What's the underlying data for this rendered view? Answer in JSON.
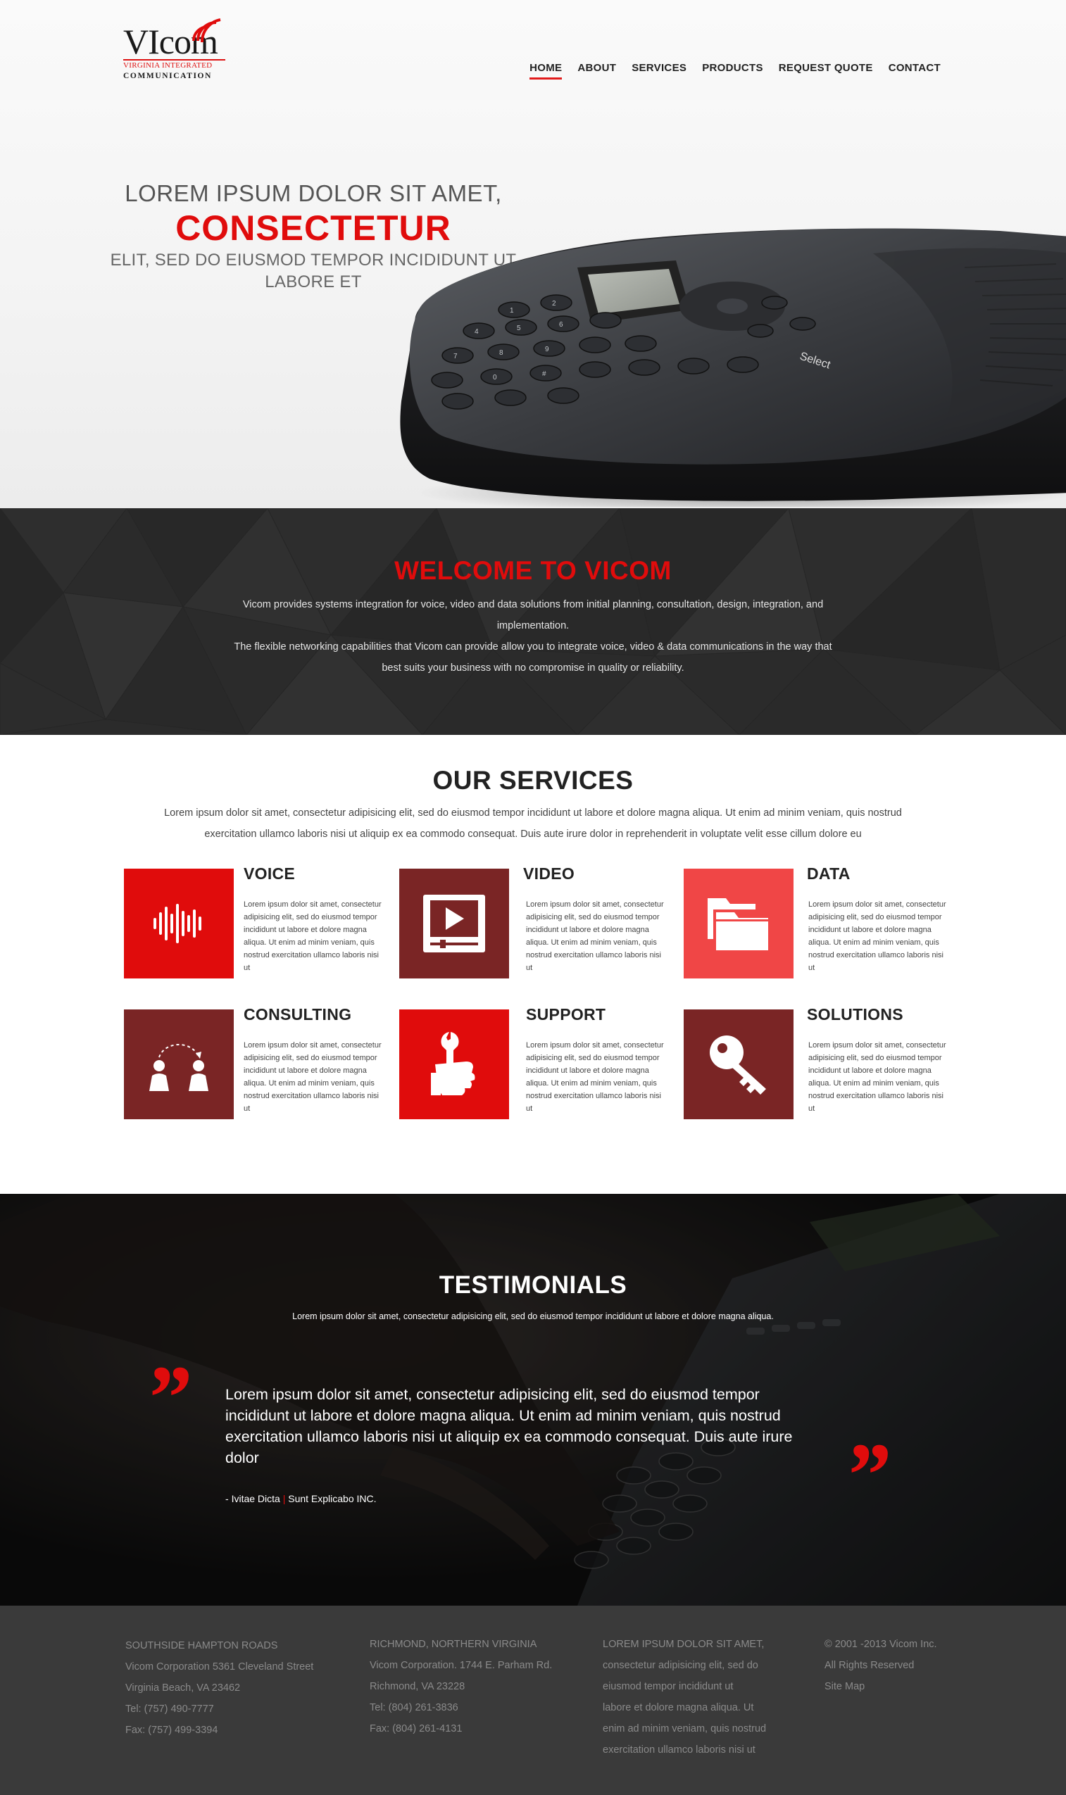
{
  "logo": {
    "main": "VIcom",
    "line1": "VIRGINIA INTEGRATED",
    "line2": "COMMUNICATION"
  },
  "nav": {
    "items": [
      {
        "label": "HOME",
        "active": true
      },
      {
        "label": "ABOUT"
      },
      {
        "label": "SERVICES"
      },
      {
        "label": "PRODUCTS"
      },
      {
        "label": "REQUEST QUOTE"
      },
      {
        "label": "CONTACT"
      }
    ]
  },
  "hero": {
    "line1": "LOREM IPSUM DOLOR SIT AMET,",
    "line2": "CONSECTETUR",
    "line3": "ELIT, SED DO EIUSMOD TEMPOR INCIDIDUNT UT LABORE ET",
    "phone_select_label": "Select"
  },
  "welcome": {
    "title": "WELCOME TO VICOM",
    "paragraph1": "Vicom provides systems integration for voice, video and data solutions from initial planning, consultation, design, integration, and implementation.",
    "paragraph2": "The flexible networking capabilities that Vicom can provide allow you to integrate voice, video & data communications in the way that best suits your business with no compromise in quality or reliability."
  },
  "services": {
    "title": "OUR SERVICES",
    "intro": "Lorem ipsum dolor sit amet, consectetur adipisicing elit, sed do eiusmod tempor incididunt ut labore et dolore magna aliqua. Ut enim ad minim veniam, quis nostrud exercitation ullamco laboris nisi ut aliquip ex ea commodo consequat. Duis aute irure dolor in reprehenderit in voluptate velit esse cillum dolore eu",
    "items": [
      {
        "title": "VOICE",
        "icon": "sound-wave-icon",
        "color": "#e00c0c",
        "text": "Lorem ipsum dolor sit amet, consectetur adipisicing elit, sed do eiusmod tempor incididunt ut labore et dolore magna aliqua. Ut enim ad minim veniam, quis nostrud exercitation ullamco laboris nisi ut"
      },
      {
        "title": "VIDEO",
        "icon": "video-player-icon",
        "color": "#7a2525",
        "text": "Lorem ipsum dolor sit amet, consectetur adipisicing elit, sed do eiusmod tempor incididunt ut labore et dolore magna aliqua. Ut enim ad minim veniam, quis nostrud exercitation ullamco laboris nisi ut"
      },
      {
        "title": "DATA",
        "icon": "folders-icon",
        "color": "#f04646",
        "text": "Lorem ipsum dolor sit amet, consectetur adipisicing elit, sed do eiusmod tempor incididunt ut labore et dolore magna aliqua. Ut enim ad minim veniam, quis nostrud exercitation ullamco laboris nisi ut"
      },
      {
        "title": "CONSULTING",
        "icon": "people-talking-icon",
        "color": "#7a2525",
        "text": "Lorem ipsum dolor sit amet, consectetur adipisicing elit, sed do eiusmod tempor incididunt ut labore et dolore magna aliqua. Ut enim ad minim veniam, quis nostrud exercitation ullamco laboris nisi ut"
      },
      {
        "title": "SUPPORT",
        "icon": "wrench-hand-icon",
        "color": "#e00c0c",
        "text": "Lorem ipsum dolor sit amet, consectetur adipisicing elit, sed do eiusmod tempor incididunt ut labore et dolore magna aliqua. Ut enim ad minim veniam, quis nostrud exercitation ullamco laboris nisi ut"
      },
      {
        "title": "SOLUTIONS",
        "icon": "key-icon",
        "color": "#7a2525",
        "text": "Lorem ipsum dolor sit amet, consectetur adipisicing elit, sed do eiusmod tempor incididunt ut labore et dolore magna aliqua. Ut enim ad minim veniam, quis nostrud exercitation ullamco laboris nisi ut"
      }
    ]
  },
  "testimonials": {
    "title": "TESTIMONIALS",
    "subtitle": "Lorem ipsum dolor sit amet, consectetur adipisicing elit, sed do eiusmod tempor incididunt ut labore et dolore magna aliqua.",
    "quote": "Lorem ipsum dolor sit amet, consectetur adipisicing elit, sed do eiusmod tempor incididunt ut labore et dolore magna aliqua. Ut enim ad minim veniam, quis nostrud exercitation ullamco laboris nisi ut aliquip ex ea commodo consequat. Duis aute irure dolor",
    "author_prefix": "- ",
    "author_name": "Ivitae Dicta",
    "author_sep": " | ",
    "author_company": "Sunt Explicabo INC.",
    "quote_mark": "”"
  },
  "footer": {
    "columns": [
      {
        "lines": [
          "SOUTHSIDE HAMPTON ROADS",
          "Vicom Corporation 5361 Cleveland Street",
          "Virginia Beach, VA 23462",
          "Tel: (757) 490-7777",
          "Fax: (757) 499-3394"
        ]
      },
      {
        "lines": [
          "RICHMOND, NORTHERN VIRGINIA",
          "Vicom Corporation. 1744 E. Parham Rd.",
          "Richmond, VA 23228",
          "Tel: (804) 261-3836",
          "Fax: (804) 261-4131"
        ]
      },
      {
        "lines": [
          "LOREM IPSUM DOLOR SIT AMET,",
          "consectetur adipisicing elit, sed do",
          "eiusmod tempor incididunt ut",
          "labore et dolore magna aliqua. Ut",
          "enim ad minim veniam, quis nostrud",
          "exercitation ullamco laboris nisi ut"
        ]
      },
      {
        "lines": [
          "© 2001 -2013 Vicom Inc.",
          "All Rights Reserved",
          "Site Map"
        ]
      }
    ]
  }
}
